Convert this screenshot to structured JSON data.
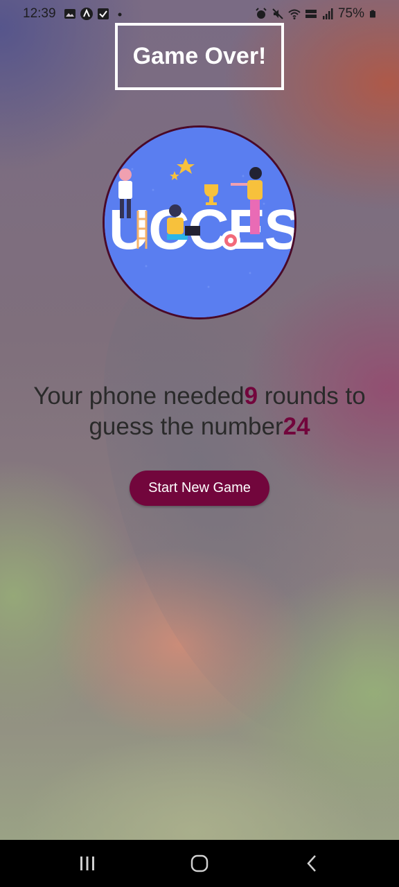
{
  "status_bar": {
    "time": "12:39",
    "battery": "75%",
    "icons_left": [
      "image-icon",
      "app-icon",
      "checkbox-icon",
      "dot-icon"
    ],
    "icons_right": [
      "alarm-icon",
      "mute-icon",
      "wifi-icon",
      "volte-icon",
      "signal-icon",
      "battery-icon"
    ]
  },
  "header": {
    "title": "Game Over!"
  },
  "result": {
    "text_before_rounds": "Your phone needed",
    "rounds": "9",
    "text_before_number": " rounds to guess the number",
    "number": "24"
  },
  "actions": {
    "start_new_game": "Start New Game"
  },
  "illustration": {
    "letters": "UCCES"
  },
  "colors": {
    "accent": "#72063c",
    "image_border": "#4a0a28",
    "title_border": "#ffffff",
    "image_bg": "#5a7ef0"
  },
  "nav_bar": {
    "buttons": [
      "recent-apps-icon",
      "home-icon",
      "back-icon"
    ]
  }
}
